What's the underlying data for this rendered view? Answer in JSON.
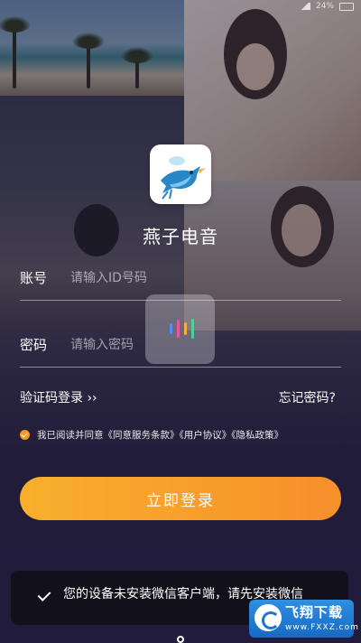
{
  "status_bar": {
    "battery_text": "24%"
  },
  "app": {
    "name": "燕子电音"
  },
  "form": {
    "account_label": "账号",
    "account_placeholder": "请输入ID号码",
    "password_label": "密码",
    "password_placeholder": "请输入密码"
  },
  "links": {
    "sms_login": "验证码登录 ››",
    "forgot_password": "忘记密码?"
  },
  "agreement": {
    "text": "我已阅读并同意《同意服务条款》《用户协议》《隐私政策》",
    "checked": true
  },
  "login_button": {
    "label": "立即登录"
  },
  "toast": {
    "message": "您的设备未安装微信客户端，请先安装微信"
  },
  "watermark": {
    "brand": "飞翔下载",
    "url": "www.FXXZ.com"
  },
  "colors": {
    "accent_orange": "#F7A12B",
    "toast_bg": "#121018",
    "watermark_blue": "#1D76CF"
  }
}
